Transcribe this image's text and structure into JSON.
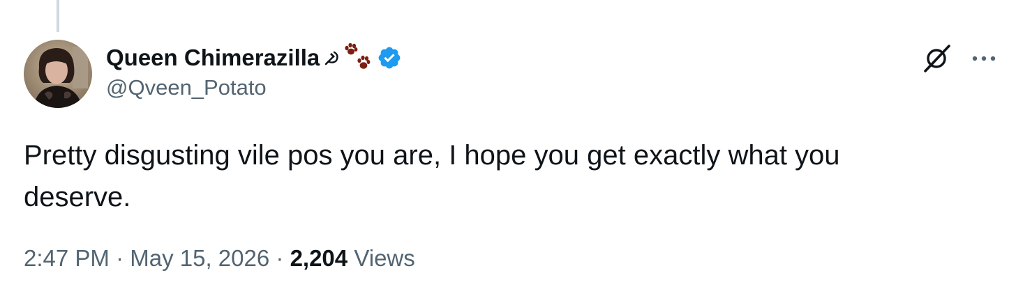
{
  "tweet": {
    "author": {
      "display_name": "Queen Chimerazilla",
      "name_emojis": [
        "hammer-and-sickle-icon",
        "paw-prints-icon"
      ],
      "handle": "@Qveen_Potato",
      "verified": true
    },
    "text": "Pretty disgusting vile pos you are, I hope you get exactly what you deserve.",
    "time": "2:47 PM",
    "date": "May 15, 2026",
    "separator": "·",
    "views_count": "2,204",
    "views_label": "Views"
  },
  "colors": {
    "primary_text": "#0f1419",
    "secondary_text": "#536471",
    "verified_blue": "#1d9bf0",
    "thread_line": "#cfd9de",
    "paw_brown": "#7a1f12"
  },
  "actions": {
    "grok_icon": "grok-icon",
    "more_icon": "more-options-icon"
  }
}
